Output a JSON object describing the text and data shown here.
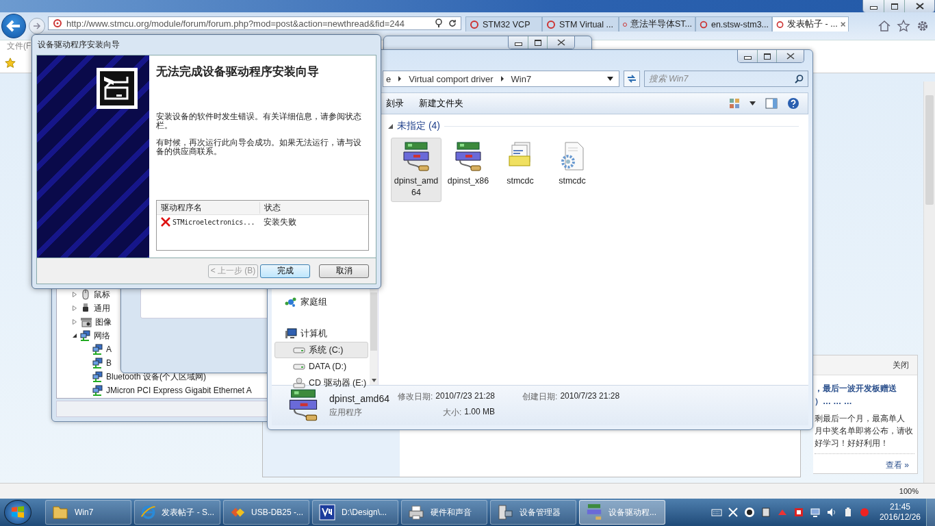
{
  "browser": {
    "url": "http://www.stmcu.org/module/forum/forum.php?mod=post&action=newthread&fid=244",
    "tabs": [
      {
        "label": "STM32 VCP",
        "selected": false
      },
      {
        "label": "STM Virtual ...",
        "selected": false
      },
      {
        "label": "意法半导体ST...",
        "selected": false
      },
      {
        "label": "en.stsw-stm3...",
        "selected": false
      },
      {
        "label": "发表帖子 - ...",
        "selected": true
      }
    ],
    "menu_item": "文件(F",
    "zoom": "100%"
  },
  "popup": {
    "close": "关闭",
    "headline": [
      "，最后一波开发板赠送",
      "）… … …"
    ],
    "body": [
      "剩最后一个月，最高单人",
      "月中奖名单即将公布，请收",
      "好学习！好好利用！"
    ],
    "more": "查看 »"
  },
  "device_manager": {
    "tree": [
      {
        "label": "鼠标",
        "expanded": false,
        "kind": "mouse"
      },
      {
        "label": "通用",
        "expanded": false,
        "kind": "usb"
      },
      {
        "label": "图像",
        "expanded": false,
        "kind": "camera"
      },
      {
        "label": "网络",
        "expanded": true,
        "kind": "network",
        "children": [
          {
            "label": "A",
            "kind": "network"
          },
          {
            "label": "B",
            "kind": "network"
          },
          {
            "label": "Bluetooth 设备(个人区域网)",
            "kind": "network"
          },
          {
            "label": "JMicron PCI Express Gigabit Ethernet A",
            "kind": "network"
          }
        ]
      }
    ]
  },
  "explorer": {
    "breadcrumb": [
      "e",
      "Virtual comport driver",
      "Win7"
    ],
    "search_placeholder": "搜索 Win7",
    "toolbar": [
      "刻录",
      "新建文件夹"
    ],
    "group": "未指定 (4)",
    "files": [
      {
        "name": "dpinst_amd64",
        "kind": "installer",
        "selected": true
      },
      {
        "name": "dpinst_x86",
        "kind": "installer",
        "selected": false
      },
      {
        "name": "stmcdc",
        "kind": "catalog",
        "selected": false
      },
      {
        "name": "stmcdc",
        "kind": "setup",
        "selected": false
      }
    ],
    "nav": [
      {
        "label": "家庭组",
        "kind": "homegroup",
        "selected": false
      },
      {
        "label": "计算机",
        "kind": "computer",
        "selected": false
      },
      {
        "label": "系统 (C:)",
        "kind": "drive",
        "selected": true
      },
      {
        "label": "DATA (D:)",
        "kind": "drive",
        "selected": false
      },
      {
        "label": "CD 驱动器 (E:)",
        "kind": "cd",
        "selected": false
      }
    ],
    "details": {
      "name": "dpinst_amd64",
      "type": "应用程序",
      "fields": [
        {
          "label": "修改日期:",
          "value": "2010/7/23 21:28"
        },
        {
          "label": "创建日期:",
          "value": "2010/7/23 21:28"
        },
        {
          "label": "大小:",
          "value": "1.00 MB"
        }
      ]
    }
  },
  "wizard": {
    "title": "设备驱动程序安装向导",
    "heading": "无法完成设备驱动程序安装向导",
    "paragraphs": [
      "安装设备的软件时发生错误。有关详细信息，请参阅状态栏。",
      "有时候，再次运行此向导会成功。如果无法运行，请与设备的供应商联系。"
    ],
    "columns": [
      "驱动程序名",
      "状态"
    ],
    "rows": [
      {
        "name": "STMicroelectronics...",
        "status": "安装失败",
        "failed": true
      }
    ],
    "buttons": [
      {
        "label": "< 上一步 (B)",
        "disabled": true,
        "default": false
      },
      {
        "label": "完成",
        "disabled": false,
        "default": true
      },
      {
        "label": "取消",
        "disabled": false,
        "default": false
      }
    ]
  },
  "taskbar": {
    "items": [
      {
        "label": "Win7",
        "kind": "folder",
        "selected": false
      },
      {
        "label": "发表帖子 - S...",
        "kind": "ie",
        "selected": false
      },
      {
        "label": "USB-DB25 -...",
        "kind": "app",
        "selected": false
      },
      {
        "label": "D:\\Design\\...",
        "kind": "v4",
        "selected": false
      },
      {
        "label": "硬件和声音",
        "kind": "printer",
        "selected": false
      },
      {
        "label": "设备管理器",
        "kind": "devmgr",
        "selected": false
      },
      {
        "label": "设备驱动程...",
        "kind": "installer",
        "selected": true
      }
    ],
    "time": "21:45",
    "date": "2016/12/26"
  }
}
